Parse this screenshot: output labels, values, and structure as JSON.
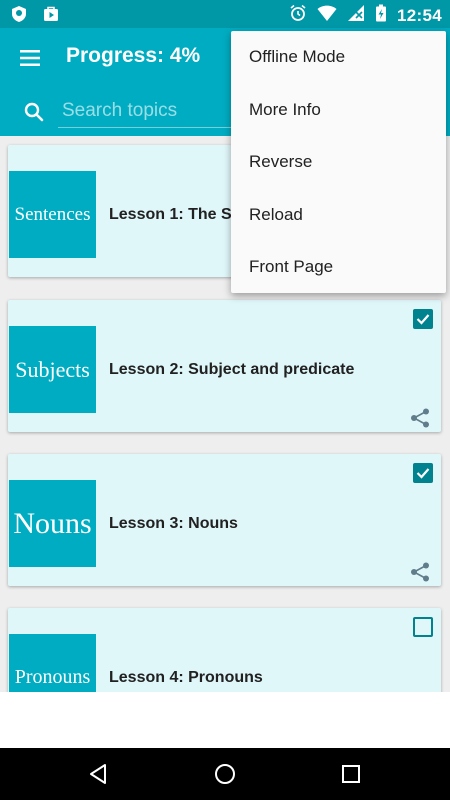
{
  "status_bar": {
    "time": "12:54",
    "left_icons": [
      "shield-icon",
      "play-store-icon"
    ],
    "right_icons": [
      "alarm-icon",
      "wifi-icon",
      "cellular-no-data-icon",
      "battery-charging-icon"
    ]
  },
  "app_bar": {
    "title": "Progress: 4%",
    "menu_icon": "hamburger-menu-icon",
    "color": "#00acc1"
  },
  "search": {
    "placeholder": "Search topics",
    "value": ""
  },
  "lessons": [
    {
      "thumb_text": "Sentences",
      "title": "Lesson 1: The S",
      "checked": true,
      "share_icon": "share-icon"
    },
    {
      "thumb_text": "Subjects",
      "title": "Lesson 2: Subject and predicate",
      "checked": true,
      "share_icon": "share-icon"
    },
    {
      "thumb_text": "Nouns",
      "title": "Lesson 3: Nouns",
      "checked": true,
      "share_icon": "share-icon"
    },
    {
      "thumb_text": "Pronouns",
      "title": "Lesson 4: Pronouns",
      "checked": false,
      "share_icon": "share-icon"
    }
  ],
  "overflow_menu": {
    "items": [
      "Offline Mode",
      "More Info",
      "Reverse",
      "Reload",
      "Front Page"
    ]
  },
  "nav_bar": {
    "buttons": [
      "back-triangle-icon",
      "home-circle-icon",
      "recents-square-icon"
    ]
  },
  "colors": {
    "status_bar": "#0097a7",
    "primary": "#00acc1",
    "card_bg": "#e0f7fa",
    "checkbox": "#00838f"
  }
}
